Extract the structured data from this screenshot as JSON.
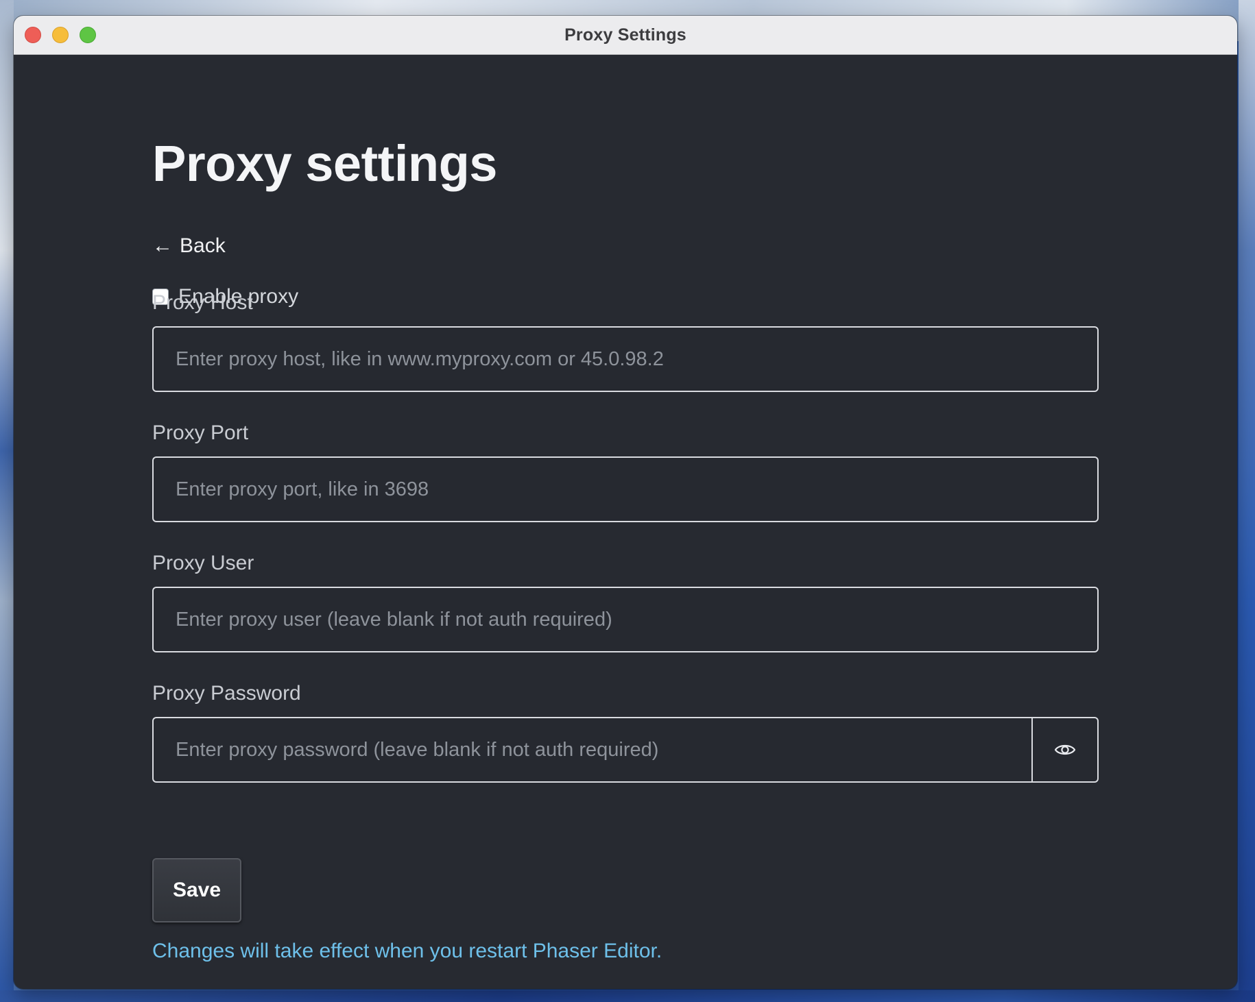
{
  "window": {
    "title": "Proxy Settings",
    "controls": [
      "close",
      "minimize",
      "maximize"
    ]
  },
  "page": {
    "title": "Proxy settings",
    "back_icon": "←",
    "back_label": "Back"
  },
  "enable_proxy": {
    "label": "Enable proxy",
    "checked": false
  },
  "fields": {
    "host": {
      "label": "Proxy Host",
      "placeholder": "Enter proxy host, like in www.myproxy.com or 45.0.98.2",
      "value": ""
    },
    "port": {
      "label": "Proxy Port",
      "placeholder": "Enter proxy port, like in 3698",
      "value": ""
    },
    "user": {
      "label": "Proxy User",
      "placeholder": "Enter proxy user (leave blank if not auth required)",
      "value": ""
    },
    "password": {
      "label": "Proxy Password",
      "placeholder": "Enter proxy password (leave blank if not auth required)",
      "value": "",
      "toggle_icon": "eye-icon"
    }
  },
  "actions": {
    "save_label": "Save"
  },
  "notice": "Changes will take effect when you restart Phaser Editor.",
  "colors": {
    "background": "#272a31",
    "notice": "#6ec0ea",
    "input_border": "#d9dbe0"
  }
}
